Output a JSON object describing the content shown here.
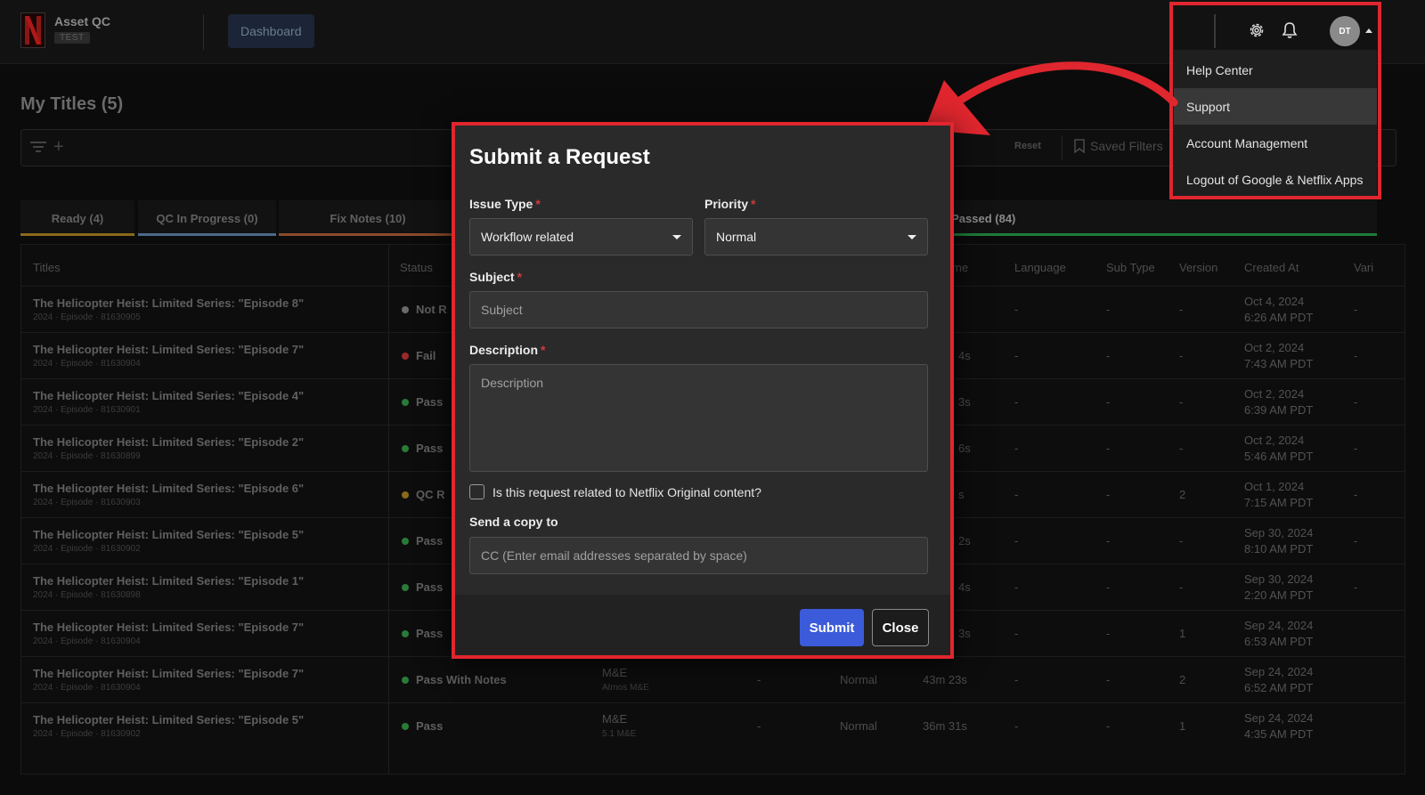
{
  "app": {
    "name": "Asset QC",
    "env": "TEST",
    "nav_dashboard": "Dashboard",
    "page_title": "My Titles (5)",
    "reset": "Reset",
    "saved_filters": "Saved Filters"
  },
  "tabs": [
    {
      "label": "Ready (4)",
      "color": "#8a6a1a"
    },
    {
      "label": "QC In Progress (0)",
      "color": "#4a6a8a"
    },
    {
      "label": "Fix Notes (10)",
      "color": "#8a4a2a"
    },
    {
      "label": "QC Passed (84)",
      "color": "#1f7a3a"
    }
  ],
  "table": {
    "headers": {
      "titles": "Titles",
      "status": "Status",
      "time": "me",
      "language": "Language",
      "sub_type": "Sub Type",
      "version": "Version",
      "created_at": "Created At",
      "variant": "Vari"
    },
    "rows": [
      {
        "title": "The Helicopter Heist: Limited Series: \"Episode 8\"",
        "sub": "2024 · Episode · 81630905",
        "status": "Not R",
        "status_color": "#6a6a6a",
        "time": "",
        "lang": "-",
        "subtype": "-",
        "version": "-",
        "date": "Oct 4, 2024",
        "clock": "6:26 AM PDT",
        "variant": "-"
      },
      {
        "title": "The Helicopter Heist: Limited Series: \"Episode 7\"",
        "sub": "2024 · Episode · 81630904",
        "status": "Fail",
        "status_color": "#9a2a2a",
        "time": "4s",
        "lang": "-",
        "subtype": "-",
        "version": "-",
        "date": "Oct 2, 2024",
        "clock": "7:43 AM PDT",
        "variant": "-"
      },
      {
        "title": "The Helicopter Heist: Limited Series: \"Episode 4\"",
        "sub": "2024 · Episode · 81630901",
        "status": "Pass",
        "status_color": "#2a7a3a",
        "time": "3s",
        "lang": "-",
        "subtype": "-",
        "version": "-",
        "date": "Oct 2, 2024",
        "clock": "6:39 AM PDT",
        "variant": "-"
      },
      {
        "title": "The Helicopter Heist: Limited Series: \"Episode 2\"",
        "sub": "2024 · Episode · 81630899",
        "status": "Pass",
        "status_color": "#2a7a3a",
        "time": "6s",
        "lang": "-",
        "subtype": "-",
        "version": "-",
        "date": "Oct 2, 2024",
        "clock": "5:46 AM PDT",
        "variant": "-"
      },
      {
        "title": "The Helicopter Heist: Limited Series: \"Episode 6\"",
        "sub": "2024 · Episode · 81630903",
        "status": "QC R",
        "status_color": "#8a6a1a",
        "time": "s",
        "lang": "-",
        "subtype": "-",
        "version": "2",
        "date": "Oct 1, 2024",
        "clock": "7:15 AM PDT",
        "variant": "-"
      },
      {
        "title": "The Helicopter Heist: Limited Series: \"Episode 5\"",
        "sub": "2024 · Episode · 81630902",
        "status": "Pass",
        "status_color": "#2a7a3a",
        "time": "2s",
        "lang": "-",
        "subtype": "-",
        "version": "-",
        "date": "Sep 30, 2024",
        "clock": "8:10 AM PDT",
        "variant": "-"
      },
      {
        "title": "The Helicopter Heist: Limited Series: \"Episode 1\"",
        "sub": "2024 · Episode · 81630898",
        "status": "Pass",
        "status_color": "#2a7a3a",
        "time": "4s",
        "lang": "-",
        "subtype": "-",
        "version": "-",
        "date": "Sep 30, 2024",
        "clock": "2:20 AM PDT",
        "variant": "-"
      },
      {
        "title": "The Helicopter Heist: Limited Series: \"Episode 7\"",
        "sub": "2024 · Episode · 81630904",
        "status": "Pass",
        "status_color": "#2a7a3a",
        "time": "3s",
        "lang": "-",
        "subtype": "-",
        "version": "1",
        "date": "Sep 24, 2024",
        "clock": "6:53 AM PDT",
        "variant": ""
      },
      {
        "title": "The Helicopter Heist: Limited Series: \"Episode 7\"",
        "sub": "2024 · Episode · 81630904",
        "status": "Pass With Notes",
        "status_color": "#2a7a3a",
        "type": "M&E",
        "type_sub": "Atmos M&E",
        "dash": "-",
        "priority": "Normal",
        "time": "43m 23s",
        "lang": "-",
        "subtype": "-",
        "version": "2",
        "date": "Sep 24, 2024",
        "clock": "6:52 AM PDT",
        "variant": ""
      },
      {
        "title": "The Helicopter Heist: Limited Series: \"Episode 5\"",
        "sub": "2024 · Episode · 81630902",
        "status": "Pass",
        "status_color": "#2a7a3a",
        "type": "M&E",
        "type_sub": "5.1 M&E",
        "dash": "-",
        "priority": "Normal",
        "time": "36m 31s",
        "lang": "-",
        "subtype": "-",
        "version": "1",
        "date": "Sep 24, 2024",
        "clock": "4:35 AM PDT",
        "variant": ""
      }
    ]
  },
  "header": {
    "avatar_initials": "DT",
    "icons": {
      "settings": "gear-icon",
      "notifications": "bell-icon"
    }
  },
  "user_menu": {
    "items": [
      "Help Center",
      "Support",
      "Account Management",
      "Logout of Google & Netflix Apps"
    ],
    "active_index": 1
  },
  "modal": {
    "title": "Submit a Request",
    "issue_type_label": "Issue Type",
    "issue_type_value": "Workflow related",
    "priority_label": "Priority",
    "priority_value": "Normal",
    "subject_label": "Subject",
    "subject_placeholder": "Subject",
    "description_label": "Description",
    "description_placeholder": "Description",
    "original_content_checkbox": "Is this request related to Netflix Original content?",
    "cc_label": "Send a copy to",
    "cc_placeholder": "CC (Enter email addresses separated by space)",
    "submit": "Submit",
    "close": "Close"
  },
  "colors": {
    "accent_blue": "#3b5bdb",
    "highlight_red": "#e0262e",
    "netflix_red": "#e50914"
  }
}
